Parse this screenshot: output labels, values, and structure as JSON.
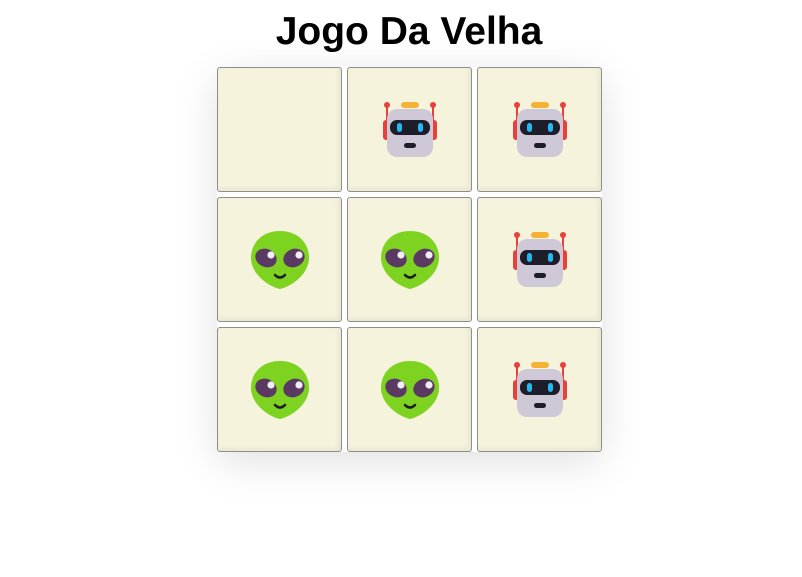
{
  "title": "Jogo Da Velha",
  "board": {
    "cells": [
      "",
      "robot",
      "robot",
      "alien",
      "alien",
      "robot",
      "alien",
      "alien",
      "robot"
    ]
  },
  "colors": {
    "cell_background": "#f5f3dc",
    "cell_border": "#8e8e8e",
    "alien_skin": "#7ed321",
    "robot_body": "#cfc8d6"
  }
}
